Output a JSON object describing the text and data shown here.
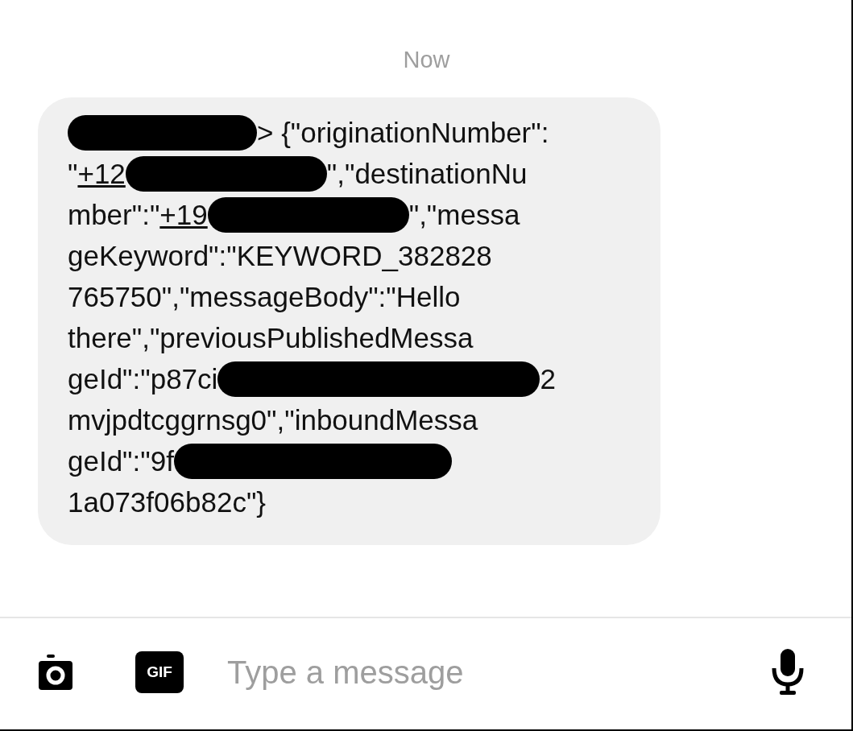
{
  "timestamp": "Now",
  "message": {
    "lines": [
      [
        {
          "kind": "redaction"
        },
        {
          "kind": "text",
          "text": "> {\"originationNumber\":"
        }
      ],
      [
        {
          "kind": "text",
          "text": "\""
        },
        {
          "kind": "link",
          "text": "+12"
        },
        {
          "kind": "redaction"
        },
        {
          "kind": "text",
          "text": "\",\"destinationNu"
        }
      ],
      [
        {
          "kind": "text",
          "text": "mber\":\""
        },
        {
          "kind": "link",
          "text": "+19"
        },
        {
          "kind": "redaction"
        },
        {
          "kind": "text",
          "text": "\",\"messa"
        }
      ],
      [
        {
          "kind": "text",
          "text": "geKeyword\":\"KEYWORD_382828"
        }
      ],
      [
        {
          "kind": "text",
          "text": "765750\",\"messageBody\":\"Hello"
        }
      ],
      [
        {
          "kind": "text",
          "text": "there\",\"previousPublishedMessa"
        }
      ],
      [
        {
          "kind": "text",
          "text": "geId\":\"p87ci"
        },
        {
          "kind": "redaction"
        },
        {
          "kind": "text",
          "text": "2"
        }
      ],
      [
        {
          "kind": "text",
          "text": "mvjpdtcggrnsg0\",\"inboundMessa"
        }
      ],
      [
        {
          "kind": "text",
          "text": "geId\":\"9f"
        },
        {
          "kind": "redaction"
        }
      ],
      [
        {
          "kind": "text",
          "text": "1a073f06b82c\"}"
        }
      ]
    ]
  },
  "composer": {
    "gif_label": "GIF",
    "placeholder": "Type a message"
  }
}
